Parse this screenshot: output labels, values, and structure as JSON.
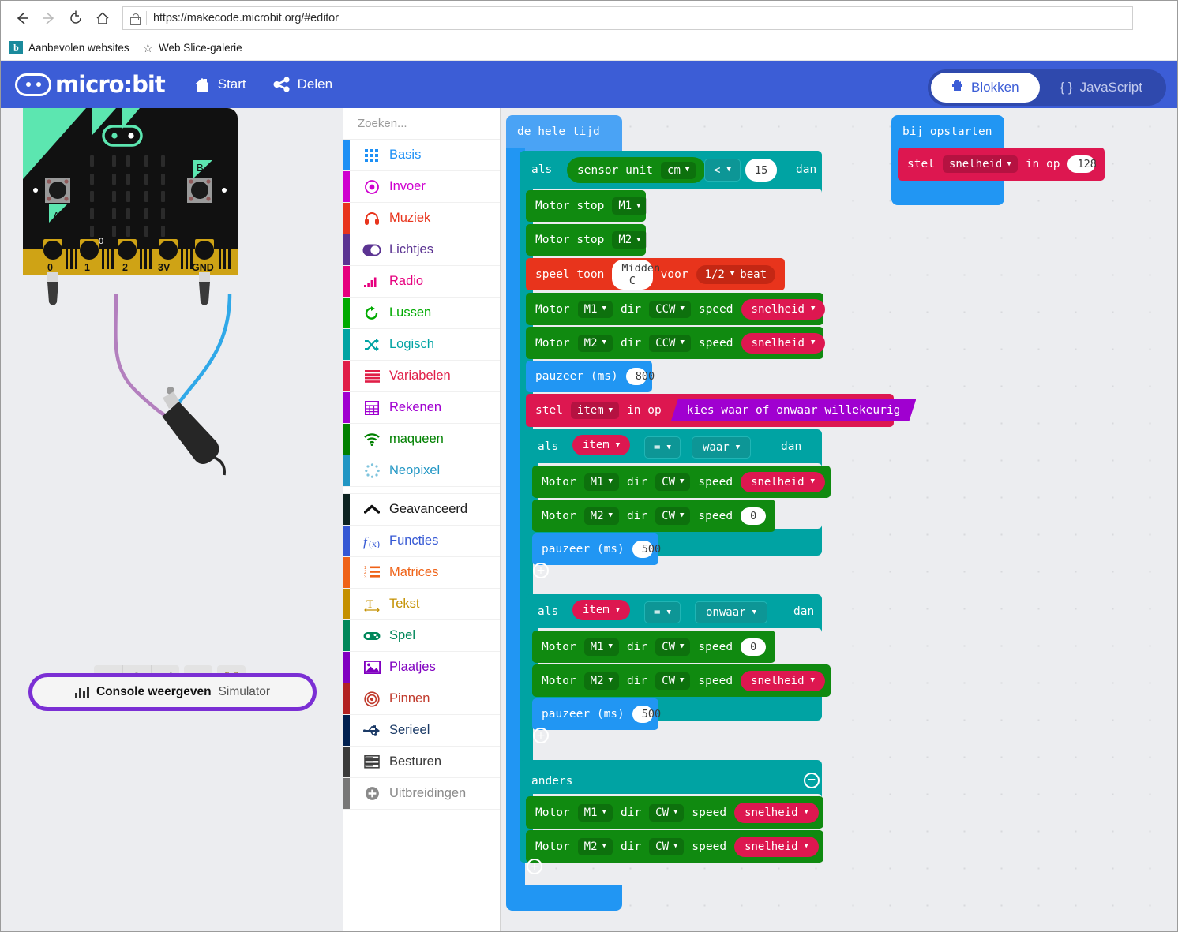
{
  "browser": {
    "url": "https://makecode.microbit.org/#editor",
    "back_icon": "back-arrow-icon",
    "forward_icon": "forward-arrow-icon",
    "reload_icon": "reload-icon",
    "home_icon": "home-icon",
    "favorites": [
      {
        "label": "Aanbevolen websites",
        "icon": "bing-icon"
      },
      {
        "label": "Web Slice-galerie",
        "icon": "star-icon"
      }
    ]
  },
  "header": {
    "logo_text": "micro:bit",
    "nav": [
      {
        "label": "Start",
        "icon": "home-icon"
      },
      {
        "label": "Delen",
        "icon": "share-icon"
      }
    ],
    "toggle": {
      "blocks_label": "Blokken",
      "js_label": "JavaScript",
      "js_braces": "{ }",
      "active": "Blokken"
    },
    "bg_color": "#3c5dd6",
    "toggle_bg_color": "#2f49ad"
  },
  "simulator": {
    "board": {
      "pin_labels": [
        "0",
        "1",
        "2",
        "3V",
        "GND"
      ],
      "button_a": "A",
      "button_b": "B",
      "extra_pin_label": "0"
    },
    "controls": [
      {
        "name": "stop-button",
        "icon": "stop-icon"
      },
      {
        "name": "restart-button",
        "icon": "restart-icon"
      },
      {
        "name": "slow-motion-button",
        "icon": "snail-icon"
      },
      {
        "name": "mute-button",
        "icon": "speaker-icon"
      },
      {
        "name": "fullscreen-button",
        "icon": "fullscreen-icon"
      }
    ],
    "console_button": {
      "label": "Console weergeven",
      "sub_label": "Simulator",
      "icon": "bar-chart-icon",
      "border_color": "#7b2fd4"
    }
  },
  "toolbox": {
    "search_placeholder": "Zoeken...",
    "search_icon": "search-icon",
    "categories": [
      {
        "label": "Basis",
        "color": "#1e90f5",
        "icon": "grid-icon"
      },
      {
        "label": "Invoer",
        "color": "#cf00cf",
        "icon": "target-icon"
      },
      {
        "label": "Muziek",
        "color": "#e8341c",
        "icon": "headphones-icon"
      },
      {
        "label": "Lichtjes",
        "color": "#5b3392",
        "icon": "toggle-icon"
      },
      {
        "label": "Radio",
        "color": "#e6007e",
        "icon": "signal-icon"
      },
      {
        "label": "Lussen",
        "color": "#00aa00",
        "icon": "loop-icon"
      },
      {
        "label": "Logisch",
        "color": "#00a3a3",
        "icon": "shuffle-icon"
      },
      {
        "label": "Variabelen",
        "color": "#e01e47",
        "icon": "lines-icon"
      },
      {
        "label": "Rekenen",
        "color": "#a000d0",
        "icon": "calculator-icon"
      },
      {
        "label": "maqueen",
        "color": "#008000",
        "icon": "wifi-icon"
      },
      {
        "label": "Neopixel",
        "color": "#2196c4",
        "icon": "dots-circle-icon"
      }
    ],
    "advanced": [
      {
        "label": "Geavanceerd",
        "color": "#0d2321",
        "icon": "chevron-up-icon",
        "text_color": "#1a1a1a"
      },
      {
        "label": "Functies",
        "color": "#3558d4",
        "icon": "function-icon",
        "text_color": "#3558d4"
      },
      {
        "label": "Matrices",
        "color": "#ef6217",
        "icon": "numbered-list-icon",
        "text_color": "#ef6217"
      },
      {
        "label": "Tekst",
        "color": "#c49000",
        "icon": "text-icon",
        "text_color": "#c49000"
      },
      {
        "label": "Spel",
        "color": "#00875a",
        "icon": "gamepad-icon",
        "text_color": "#00875a"
      },
      {
        "label": "Plaatjes",
        "color": "#8000c0",
        "icon": "image-icon",
        "text_color": "#8000c0"
      },
      {
        "label": "Pinnen",
        "color": "#b22222",
        "icon": "bullseye-icon",
        "text_color": "#c0392b"
      },
      {
        "label": "Serieel",
        "color": "#002050",
        "icon": "usb-icon",
        "text_color": "#1b3a66"
      },
      {
        "label": "Besturen",
        "color": "#3a3a3a",
        "icon": "stack-icon",
        "text_color": "#3a3a3a"
      },
      {
        "label": "Uitbreidingen",
        "color": "#777777",
        "icon": "plus-circle-icon",
        "text_color": "#8a8a8a"
      }
    ]
  },
  "workspace": {
    "forever_block": {
      "title": "de hele tijd",
      "color": "#2196f3"
    },
    "startup_block": {
      "title": "bij opstarten",
      "color": "#2196f3",
      "statement": {
        "keyword": "stel",
        "variable": "snelheid",
        "connector": "in op",
        "value": "128"
      }
    },
    "if_sensor": {
      "if_label": "als",
      "then_label": "dan",
      "condition": {
        "sensor_label": "sensor unit",
        "unit": "cm",
        "operator": "<",
        "value": "15"
      }
    },
    "statements_top": [
      {
        "type": "motor-stop",
        "label": "Motor stop",
        "motor": "M1"
      },
      {
        "type": "motor-stop",
        "label": "Motor stop",
        "motor": "M2"
      },
      {
        "type": "play-tone",
        "label": "speel toon",
        "note": "Midden C",
        "for_label": "voor",
        "duration": "1/2",
        "beat_label": "beat"
      },
      {
        "type": "motor",
        "label": "Motor",
        "motor": "M1",
        "dir_label": "dir",
        "dir": "CCW",
        "speed_label": "speed",
        "speed_var": "snelheid"
      },
      {
        "type": "motor",
        "label": "Motor",
        "motor": "M2",
        "dir_label": "dir",
        "dir": "CCW",
        "speed_label": "speed",
        "speed_var": "snelheid"
      },
      {
        "type": "pause",
        "label": "pauzeer (ms)",
        "value": "800"
      },
      {
        "type": "set-var",
        "keyword": "stel",
        "variable": "item",
        "connector": "in op",
        "expression": "kies waar of onwaar willekeurig"
      }
    ],
    "if_true": {
      "if_label": "als",
      "then_label": "dan",
      "variable": "item",
      "operator": "=",
      "compare_value": "waar",
      "body": [
        {
          "type": "motor",
          "label": "Motor",
          "motor": "M1",
          "dir_label": "dir",
          "dir": "CW",
          "speed_label": "speed",
          "speed_var": "snelheid"
        },
        {
          "type": "motor",
          "label": "Motor",
          "motor": "M2",
          "dir_label": "dir",
          "dir": "CW",
          "speed_label": "speed",
          "speed_value": "0"
        },
        {
          "type": "pause",
          "label": "pauzeer (ms)",
          "value": "500"
        }
      ]
    },
    "if_false": {
      "if_label": "als",
      "then_label": "dan",
      "variable": "item",
      "operator": "=",
      "compare_value": "onwaar",
      "body": [
        {
          "type": "motor",
          "label": "Motor",
          "motor": "M1",
          "dir_label": "dir",
          "dir": "CW",
          "speed_label": "speed",
          "speed_value": "0"
        },
        {
          "type": "motor",
          "label": "Motor",
          "motor": "M2",
          "dir_label": "dir",
          "dir": "CW",
          "speed_label": "speed",
          "speed_var": "snelheid"
        },
        {
          "type": "pause",
          "label": "pauzeer (ms)",
          "value": "500"
        }
      ]
    },
    "else_branch": {
      "label": "anders",
      "body": [
        {
          "type": "motor",
          "label": "Motor",
          "motor": "M1",
          "dir_label": "dir",
          "dir": "CW",
          "speed_label": "speed",
          "speed_var": "snelheid"
        },
        {
          "type": "motor",
          "label": "Motor",
          "motor": "M2",
          "dir_label": "dir",
          "dir": "CW",
          "speed_label": "speed",
          "speed_var": "snelheid"
        }
      ]
    },
    "colors": {
      "event": "#2196f3",
      "logic": "#00a3a3",
      "motor": "#108a10",
      "music": "#e8341c",
      "variable": "#dd1750",
      "math": "#a000d0"
    }
  }
}
